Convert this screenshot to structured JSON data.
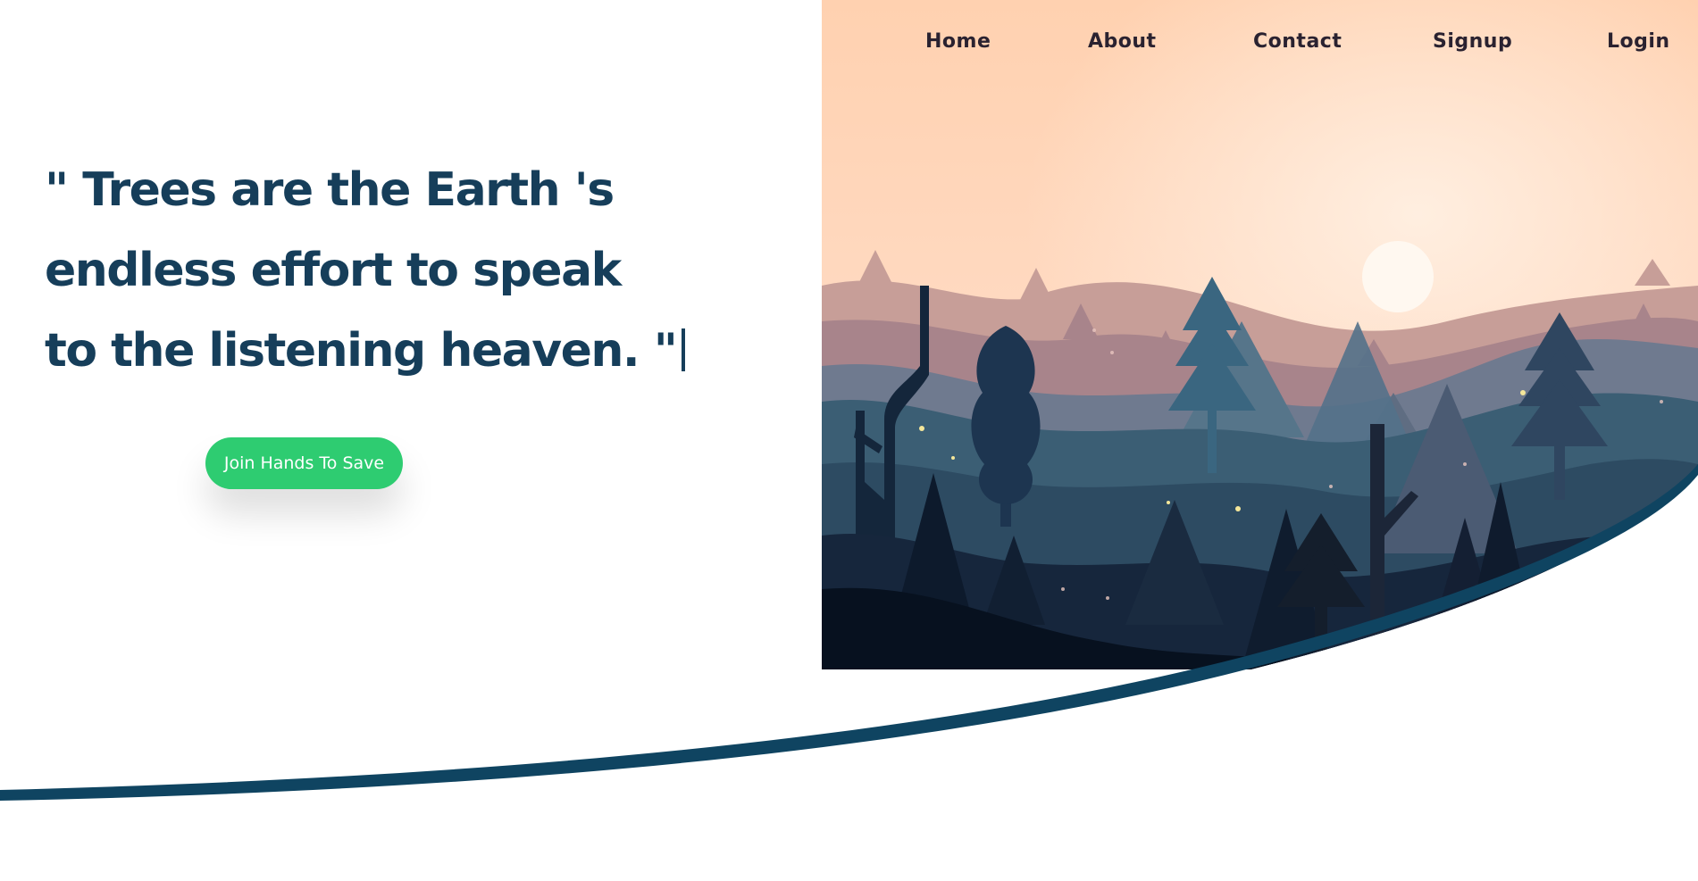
{
  "nav": {
    "home": "Home",
    "about": "About",
    "contact": "Contact",
    "signup": "Signup",
    "login": "Login"
  },
  "hero": {
    "quote_lines": [
      "\" Trees are the Earth 's",
      "endless effort to speak",
      "to the listening heaven. \""
    ],
    "cta_label": "Join Hands To Save"
  },
  "colors": {
    "heading": "#163e5a",
    "cta_bg": "#2ecc71",
    "swoosh": "#0f4461",
    "sky_top": "#ffd3b4",
    "nav_text": "#2a2230"
  },
  "illustration": {
    "name": "forest-sunset-illustration"
  }
}
